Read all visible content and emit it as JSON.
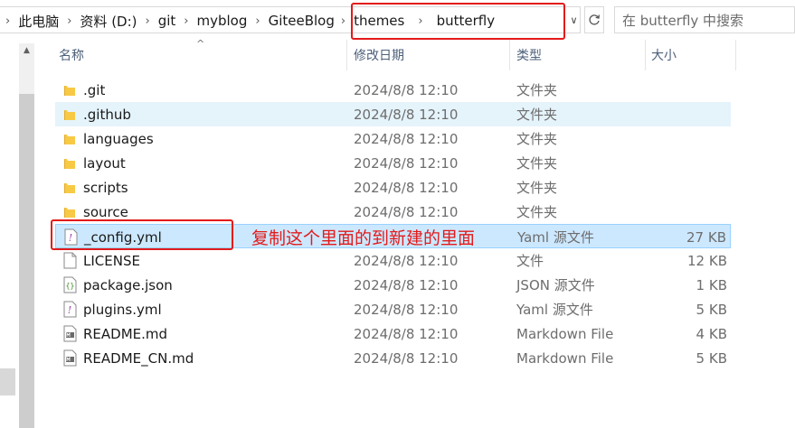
{
  "address_bar": {
    "breadcrumbs": [
      "此电脑",
      "资料 (D:)",
      "git",
      "myblog",
      "GiteeBlog",
      "themes",
      "butterfly"
    ],
    "search_placeholder": "在 butterfly 中搜索"
  },
  "columns": {
    "name": "名称",
    "date": "修改日期",
    "type": "类型",
    "size": "大小"
  },
  "files": [
    {
      "name": ".git",
      "date": "2024/8/8 12:10",
      "type": "文件夹",
      "size": "",
      "icon": "folder-icon"
    },
    {
      "name": ".github",
      "date": "2024/8/8 12:10",
      "type": "文件夹",
      "size": "",
      "icon": "folder-icon"
    },
    {
      "name": "languages",
      "date": "2024/8/8 12:10",
      "type": "文件夹",
      "size": "",
      "icon": "folder-icon"
    },
    {
      "name": "layout",
      "date": "2024/8/8 12:10",
      "type": "文件夹",
      "size": "",
      "icon": "folder-icon"
    },
    {
      "name": "scripts",
      "date": "2024/8/8 12:10",
      "type": "文件夹",
      "size": "",
      "icon": "folder-icon"
    },
    {
      "name": "source",
      "date": "2024/8/8 12:10",
      "type": "文件夹",
      "size": "",
      "icon": "folder-icon"
    },
    {
      "name": "_config.yml",
      "date": "",
      "type": "Yaml 源文件",
      "size": "27 KB",
      "icon": "yaml-file-icon"
    },
    {
      "name": "LICENSE",
      "date": "2024/8/8 12:10",
      "type": "文件",
      "size": "12 KB",
      "icon": "blank-file-icon"
    },
    {
      "name": "package.json",
      "date": "2024/8/8 12:10",
      "type": "JSON 源文件",
      "size": "1 KB",
      "icon": "json-file-icon"
    },
    {
      "name": "plugins.yml",
      "date": "2024/8/8 12:10",
      "type": "Yaml 源文件",
      "size": "5 KB",
      "icon": "yaml-file-icon"
    },
    {
      "name": "README.md",
      "date": "2024/8/8 12:10",
      "type": "Markdown File",
      "size": "4 KB",
      "icon": "markdown-file-icon"
    },
    {
      "name": "README_CN.md",
      "date": "2024/8/8 12:10",
      "type": "Markdown File",
      "size": "5 KB",
      "icon": "markdown-file-icon"
    }
  ],
  "annotation": {
    "text": "复制这个里面的到新建的里面",
    "color": "#e31a1a"
  },
  "colors": {
    "hover_row": "#e5f3fb",
    "selected_row": "#cce8ff",
    "folder": "#f8c945"
  }
}
